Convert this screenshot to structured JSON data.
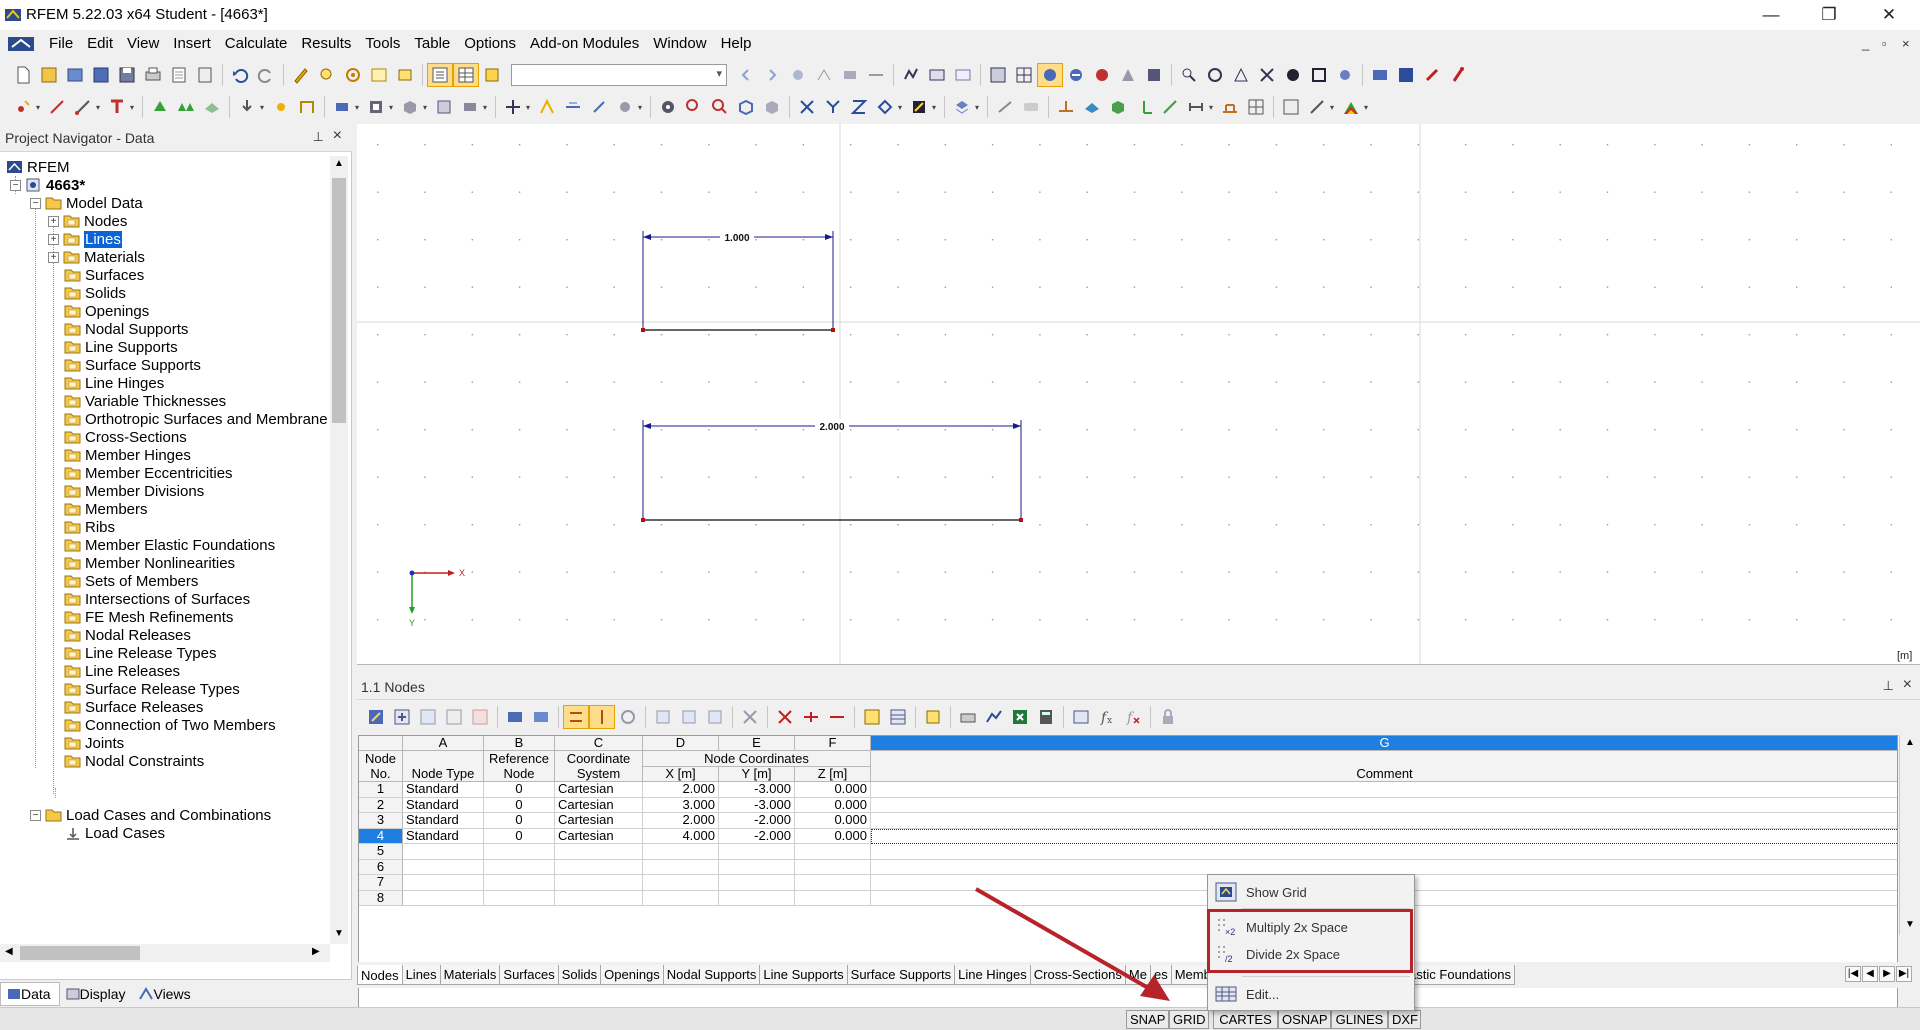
{
  "window": {
    "title": "RFEM 5.22.03 x64 Student - [4663*]",
    "controls": [
      "—",
      "❐",
      "✕"
    ]
  },
  "menubar": {
    "items": [
      "File",
      "Edit",
      "View",
      "Insert",
      "Calculate",
      "Results",
      "Tools",
      "Table",
      "Options",
      "Add-on Modules",
      "Window",
      "Help"
    ],
    "mdi_controls": [
      "_",
      "▫",
      "×"
    ]
  },
  "navigator": {
    "title": "Project Navigator - Data",
    "root": "RFEM",
    "project": "4663*",
    "model_data": "Model Data",
    "items": [
      "Nodes",
      "Lines",
      "Materials",
      "Surfaces",
      "Solids",
      "Openings",
      "Nodal Supports",
      "Line Supports",
      "Surface Supports",
      "Line Hinges",
      "Variable Thicknesses",
      "Orthotropic Surfaces and Membrane",
      "Cross-Sections",
      "Member Hinges",
      "Member Eccentricities",
      "Member Divisions",
      "Members",
      "Ribs",
      "Member Elastic Foundations",
      "Member Nonlinearities",
      "Sets of Members",
      "Intersections of Surfaces",
      "FE Mesh Refinements",
      "Nodal Releases",
      "Line Release Types",
      "Line Releases",
      "Surface Release Types",
      "Surface Releases",
      "Connection of Two Members",
      "Joints",
      "Nodal Constraints"
    ],
    "selected": "Lines",
    "load_cases": "Load Cases and Combinations",
    "load_cases_child": "Load Cases",
    "tabs": [
      "Data",
      "Display",
      "Views"
    ]
  },
  "graphics": {
    "dim1": "1.000",
    "dim2": "2.000",
    "axis_x": "X",
    "axis_y": "Y",
    "unit": "[m]"
  },
  "table": {
    "title": "1.1 Nodes",
    "col_letters": [
      "A",
      "B",
      "C",
      "D",
      "E",
      "F",
      "G"
    ],
    "node_no_1": "Node",
    "node_no_2": "No.",
    "node_type": "Node Type",
    "ref_node_1": "Reference",
    "ref_node_2": "Node",
    "coord_sys_1": "Coordinate",
    "coord_sys_2": "System",
    "node_coords": "Node Coordinates",
    "x": "X [m]",
    "y": "Y [m]",
    "z": "Z [m]",
    "comment": "Comment",
    "rows": [
      {
        "no": "1",
        "type": "Standard",
        "ref": "0",
        "sys": "Cartesian",
        "x": "2.000",
        "y": "-3.000",
        "z": "0.000"
      },
      {
        "no": "2",
        "type": "Standard",
        "ref": "0",
        "sys": "Cartesian",
        "x": "3.000",
        "y": "-3.000",
        "z": "0.000"
      },
      {
        "no": "3",
        "type": "Standard",
        "ref": "0",
        "sys": "Cartesian",
        "x": "2.000",
        "y": "-2.000",
        "z": "0.000"
      },
      {
        "no": "4",
        "type": "Standard",
        "ref": "0",
        "sys": "Cartesian",
        "x": "4.000",
        "y": "-2.000",
        "z": "0.000"
      }
    ],
    "empty_rows": [
      "5",
      "6",
      "7",
      "8"
    ],
    "tabs": [
      "Nodes",
      "Lines",
      "Materials",
      "Surfaces",
      "Solids",
      "Openings",
      "Nodal Supports",
      "Line Supports",
      "Surface Supports",
      "Line Hinges",
      "Cross-Sections",
      "Me",
      "es",
      "Member Divisions",
      "Members",
      "Member Elastic Foundations"
    ]
  },
  "context_menu": {
    "show_grid": "Show Grid",
    "multiply": "Multiply 2x Space",
    "divide": "Divide 2x Space",
    "edit": "Edit..."
  },
  "statusbar": {
    "buttons": [
      "SNAP",
      "GRID",
      "CARTES",
      "OSNAP",
      "GLINES",
      "DXF"
    ]
  },
  "colors": {
    "accent": "#1f7fe0",
    "selection": "#0a64d6",
    "highlight": "#b8232a",
    "dimension": "#1a1a8c"
  }
}
